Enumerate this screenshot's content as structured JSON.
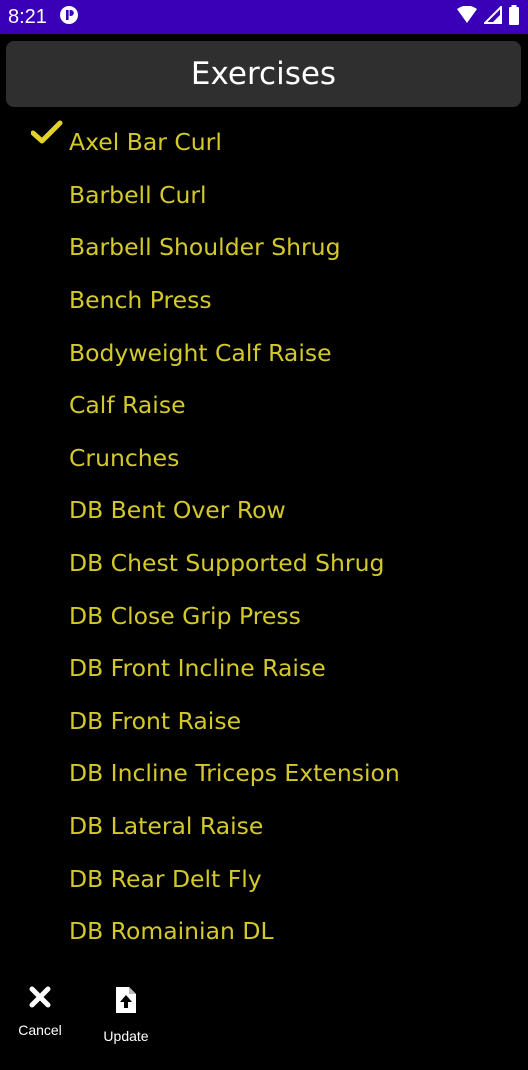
{
  "status_bar": {
    "time": "8:21"
  },
  "header": {
    "title": "Exercises"
  },
  "exercises": [
    {
      "label": "Axel Bar Curl",
      "checked": true
    },
    {
      "label": "Barbell Curl"
    },
    {
      "label": "Barbell Shoulder Shrug"
    },
    {
      "label": "Bench Press"
    },
    {
      "label": "Bodyweight Calf Raise"
    },
    {
      "label": "Calf Raise"
    },
    {
      "label": "Crunches"
    },
    {
      "label": "DB Bent Over Row"
    },
    {
      "label": "DB Chest Supported Shrug"
    },
    {
      "label": "DB Close Grip Press"
    },
    {
      "label": "DB Front Incline Raise"
    },
    {
      "label": "DB Front Raise"
    },
    {
      "label": "DB Incline Triceps Extension"
    },
    {
      "label": "DB Lateral Raise"
    },
    {
      "label": "DB Rear Delt Fly"
    },
    {
      "label": "DB Romainian DL"
    }
  ],
  "bottom_bar": {
    "cancel_label": "Cancel",
    "update_label": "Update"
  },
  "colors": {
    "status_bar": "#3a00b8",
    "header_bg": "#2f2f2f",
    "item_text": "#d4c92a",
    "check": "#e3d22a"
  },
  "icons": {
    "check": "check-icon",
    "cancel": "close-icon",
    "update": "file-upload-icon"
  }
}
